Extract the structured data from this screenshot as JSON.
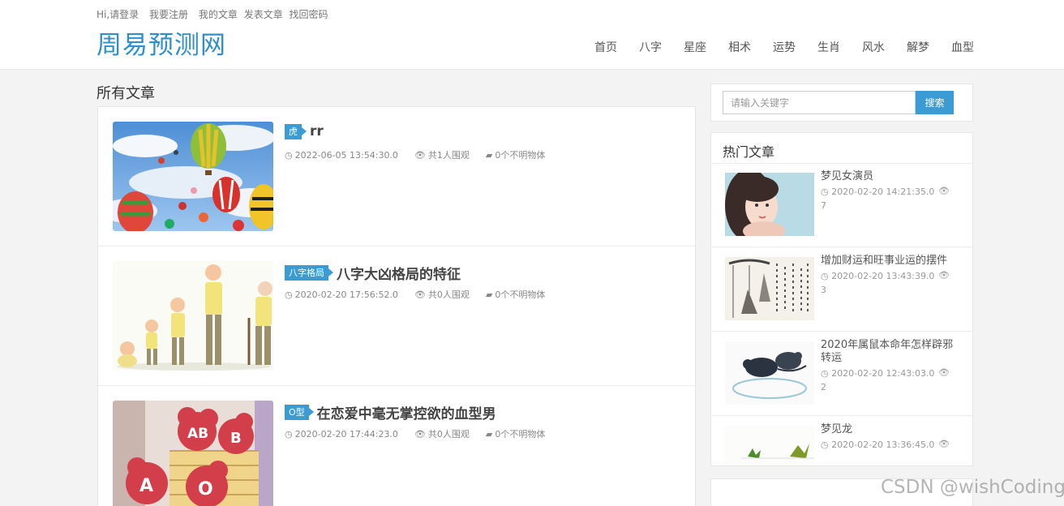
{
  "header": {
    "top_links": [
      "Hi,请登录",
      "我要注册",
      "我的文章",
      "发表文章",
      "找回密码"
    ],
    "logo": "周易预测网",
    "nav": [
      "首页",
      "八字",
      "星座",
      "相术",
      "运势",
      "生肖",
      "风水",
      "解梦",
      "血型"
    ]
  },
  "main": {
    "section_title": "所有文章",
    "articles": [
      {
        "category": "虎",
        "title": "rr",
        "date": "2022-06-05 13:54:30.0",
        "views": "共1人围观",
        "comments": "0个不明物体",
        "image": "hot-air-balloons"
      },
      {
        "category": "八字格局",
        "title": "八字大凶格局的特征",
        "date": "2020-02-20 17:56:52.0",
        "views": "共0人围观",
        "comments": "0个不明物体",
        "image": "human-growth-stages"
      },
      {
        "category": "O型",
        "title": "在恋爱中毫无掌控欲的血型男",
        "date": "2020-02-20 17:44:23.0",
        "views": "共0人围观",
        "comments": "0个不明物体",
        "image": "blood-type-flowers"
      }
    ]
  },
  "sidebar": {
    "search": {
      "placeholder": "请输入关键字",
      "button": "搜索"
    },
    "hot_title": "热门文章",
    "hot_articles": [
      {
        "title": "梦见女演员",
        "date": "2020-02-20 14:21:35.0",
        "views": "7",
        "image": "actress-portrait"
      },
      {
        "title": "增加财运和旺事业运的摆件",
        "date": "2020-02-20 13:43:39.0",
        "views": "3",
        "image": "ink-painting-lotus"
      },
      {
        "title": "2020年属鼠本命年怎样辟邪转运",
        "date": "2020-02-20 12:43:03.0",
        "views": "2",
        "image": "ink-mice"
      },
      {
        "title": "梦见龙",
        "date": "2020-02-20 13:36:45.0",
        "views": "",
        "image": "plants-sketch"
      }
    ]
  },
  "watermark": "CSDN @wishCoding",
  "colors": {
    "brand": "#2e8fc9",
    "accent": "#3a9bd5",
    "background": "#f3f3f3"
  },
  "icons": {
    "date": "clock-icon",
    "views": "eye-icon",
    "comments": "comment-icon"
  }
}
